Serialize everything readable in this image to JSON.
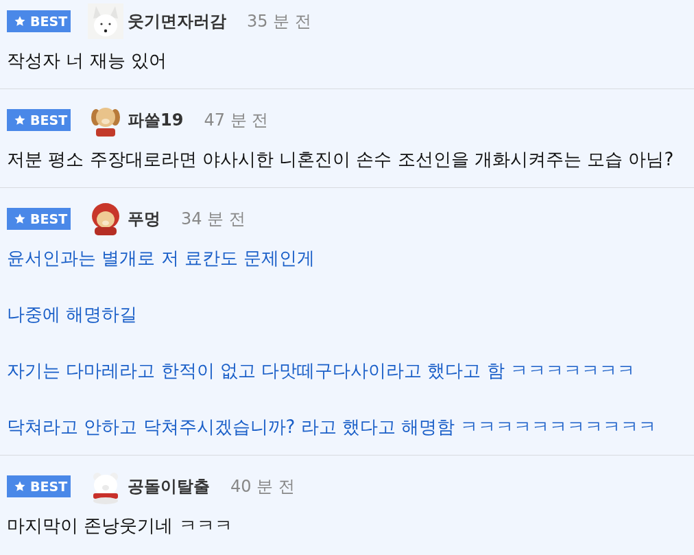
{
  "comments": [
    {
      "badge": "BEST",
      "author": "웃기면자러감",
      "time": "35 분 전",
      "kind": "plain",
      "paragraphs": [
        "작성자 너 재능 있어"
      ]
    },
    {
      "badge": "BEST",
      "author": "파쓸19",
      "time": "47 분 전",
      "kind": "plain",
      "paragraphs": [
        "저분 평소 주장대로라면 야사시한 니혼진이 손수 조선인을 개화시켜주는 모습 아님?"
      ]
    },
    {
      "badge": "BEST",
      "author": "푸멍",
      "time": "34 분 전",
      "kind": "highlighted",
      "paragraphs": [
        "윤서인과는 별개로 저 료칸도 문제인게",
        "나중에 해명하길",
        "자기는 다마레라고 한적이 없고 다맛떼구다사이라고 했다고 함 ㅋㅋㅋㅋㅋㅋㅋ",
        "닥쳐라고 안하고 닥쳐주시겠습니까? 라고 했다고 해명함 ㅋㅋㅋㅋㅋㅋㅋㅋㅋㅋㅋ"
      ]
    },
    {
      "badge": "BEST",
      "author": "공돌이탈출",
      "time": "40 분 전",
      "kind": "plain",
      "paragraphs": [
        "마지막이 존낭웃기네 ㅋㅋㅋ"
      ]
    }
  ]
}
